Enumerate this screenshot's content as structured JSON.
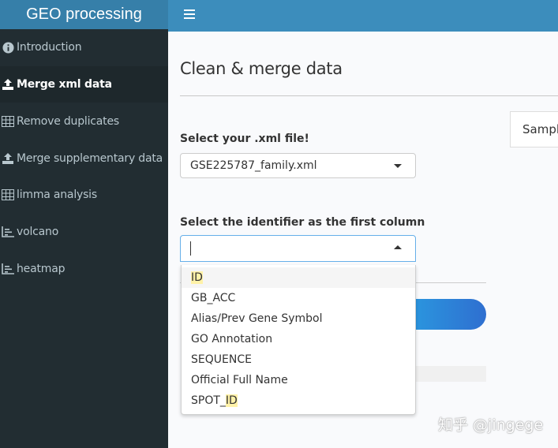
{
  "app": {
    "title": "GEO processing"
  },
  "sidebar": {
    "items": [
      {
        "label": "Introduction",
        "icon": "info-circle-icon"
      },
      {
        "label": "Merge xml data",
        "icon": "upload-icon",
        "active": true
      },
      {
        "label": "Remove duplicates",
        "icon": "table-icon"
      },
      {
        "label": "Merge supplementary data",
        "icon": "upload-icon"
      },
      {
        "label": "limma analysis",
        "icon": "table-icon"
      },
      {
        "label": "volcano",
        "icon": "chart-icon"
      },
      {
        "label": "heatmap",
        "icon": "chart-icon"
      }
    ]
  },
  "main": {
    "title": "Clean & merge data",
    "side_tab": "Sample",
    "xml_label": "Select your .xml file!",
    "xml_value": "GSE225787_family.xml",
    "identifier_label": "Select the identifier as the first column",
    "identifier_value": "",
    "options_hl_text": [
      "ID",
      "GB_ACC",
      "Alias/Prev Gene Symbol",
      "GO Annotation",
      "SEQUENCE",
      "Official Full Name",
      "SPOT_"
    ],
    "options": [
      {
        "pre": "",
        "hl": "ID",
        "post": ""
      },
      {
        "pre": "GB_ACC",
        "hl": "",
        "post": ""
      },
      {
        "pre": "Alias/Prev Gene Symbol",
        "hl": "",
        "post": ""
      },
      {
        "pre": "GO Annotation",
        "hl": "",
        "post": ""
      },
      {
        "pre": "SEQUENCE",
        "hl": "",
        "post": ""
      },
      {
        "pre": "Official Full Name",
        "hl": "",
        "post": ""
      },
      {
        "pre": "SPOT_",
        "hl": "ID",
        "post": ""
      }
    ]
  },
  "watermark": "知乎 @jingege",
  "colors": {
    "sidebar_bg": "#222d32",
    "header": "#3c8dbc",
    "brand": "#367fa9",
    "highlight": "#fff2a8"
  }
}
